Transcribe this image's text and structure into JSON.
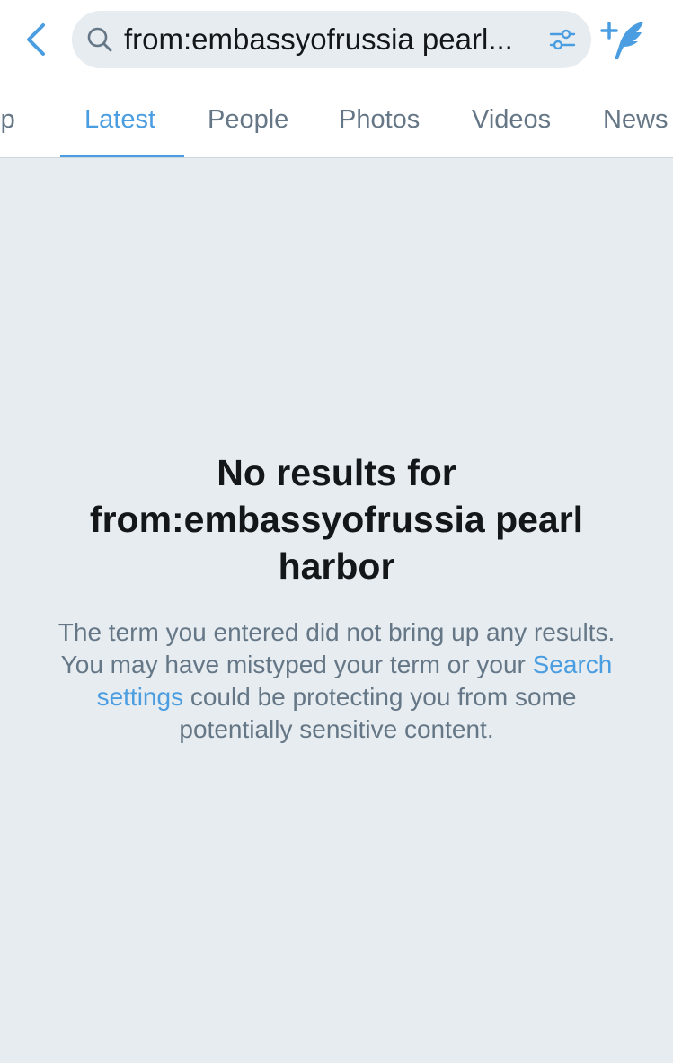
{
  "header": {
    "search_query": "from:embassyofrussia pearl...",
    "back_icon": "chevron-left-icon",
    "search_icon": "search-icon",
    "filter_icon": "sliders-icon",
    "compose_icon": "compose-tweet-icon"
  },
  "tabs": [
    {
      "label": "Top",
      "active": false
    },
    {
      "label": "Latest",
      "active": true
    },
    {
      "label": "People",
      "active": false
    },
    {
      "label": "Photos",
      "active": false
    },
    {
      "label": "Videos",
      "active": false
    },
    {
      "label": "News",
      "active": false
    }
  ],
  "empty_state": {
    "title_line1": "No results for",
    "title_line2": "from:embassyofrussia pearl",
    "title_line3": "harbor",
    "body_before_link": "The term you entered did not bring up any results. You may have mistyped your term or your ",
    "link_text": "Search settings",
    "body_after_link": " could be protecting you from some potentially sensitive content."
  },
  "colors": {
    "accent": "#4A9DE0",
    "background": "#E6ECF0",
    "text_primary": "#14171A",
    "text_secondary": "#657786"
  }
}
